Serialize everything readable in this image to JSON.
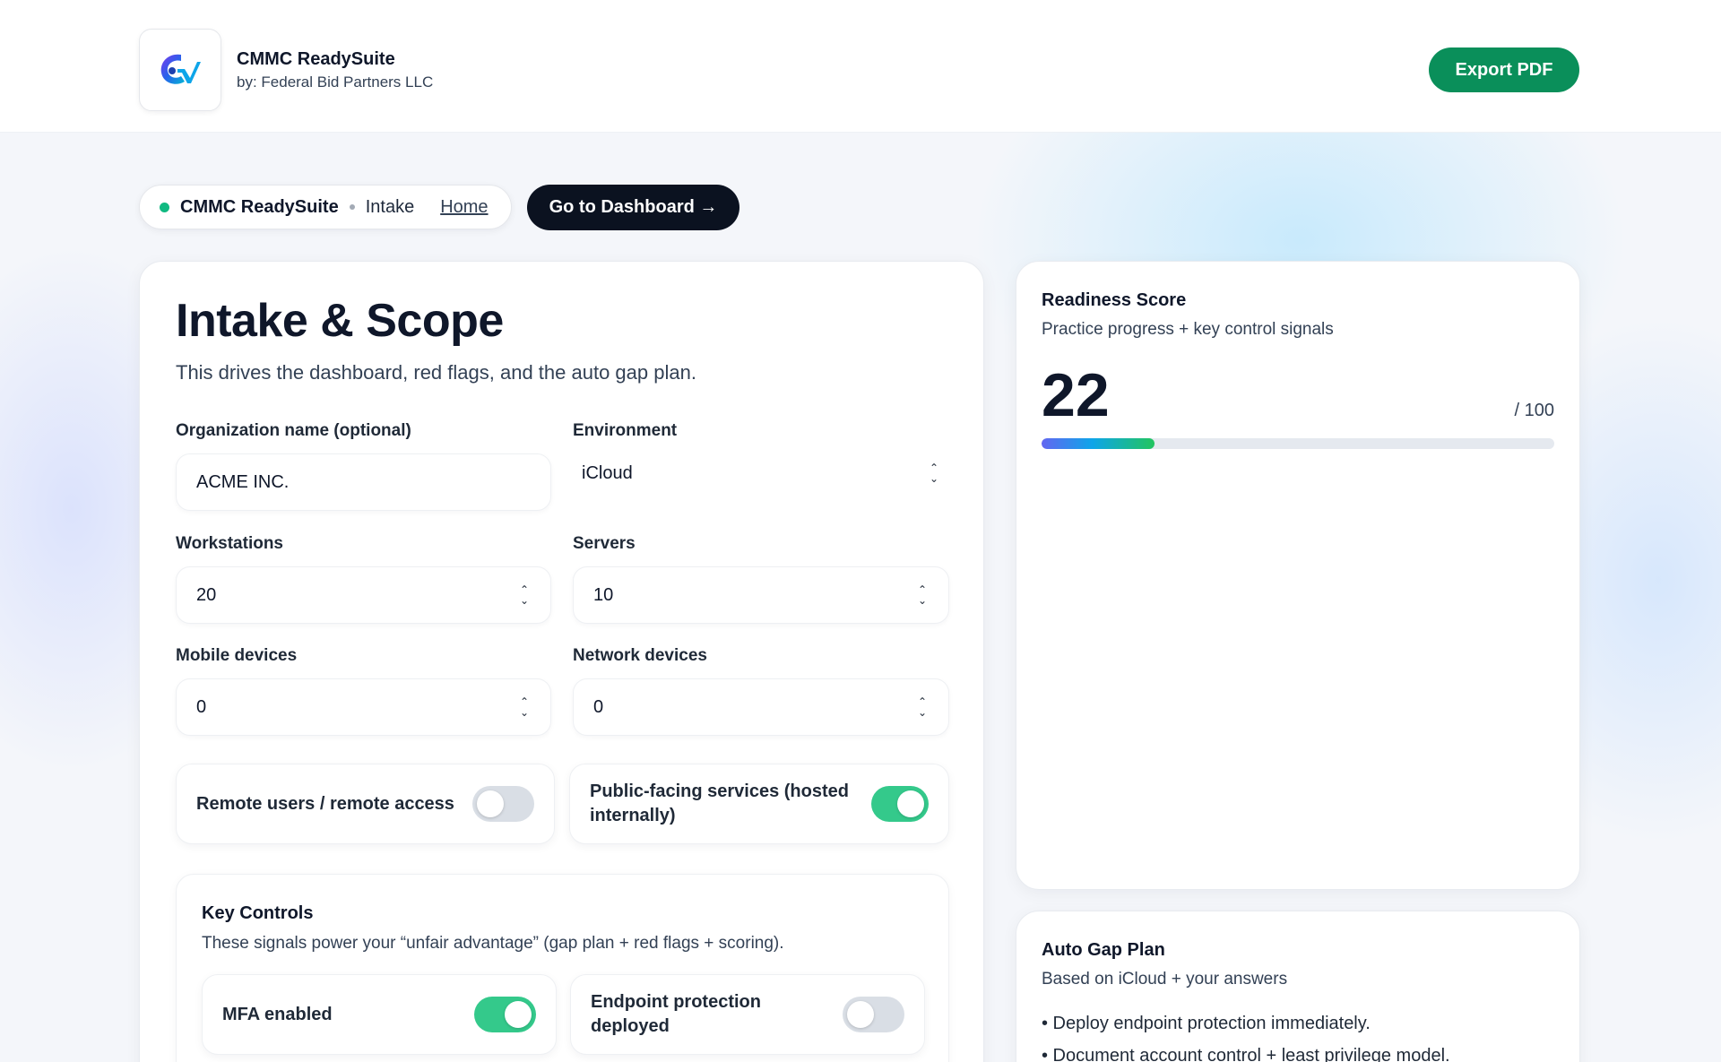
{
  "header": {
    "app_name": "CMMC ReadySuite",
    "byline": "by: Federal Bid Partners LLC",
    "export_label": "Export PDF"
  },
  "breadcrumb": {
    "app": "CMMC ReadySuite",
    "page": "Intake",
    "home_link": "Home"
  },
  "dashboard_button": "Go to Dashboard →",
  "intake": {
    "title": "Intake & Scope",
    "subtitle": "This drives the dashboard, red flags, and the auto gap plan.",
    "org_label": "Organization name (optional)",
    "org_value": "ACME INC.",
    "env_label": "Environment",
    "env_value": "iCloud",
    "workstations_label": "Workstations",
    "workstations_value": "20",
    "servers_label": "Servers",
    "servers_value": "10",
    "mobile_label": "Mobile devices",
    "mobile_value": "0",
    "network_label": "Network devices",
    "network_value": "0",
    "remote_label": "Remote users / remote access",
    "remote_on": false,
    "public_label": "Public-facing services (hosted internally)",
    "public_on": true
  },
  "key_controls": {
    "title": "Key Controls",
    "subtitle": "These signals power your “unfair advantage” (gap plan + red flags + scoring).",
    "mfa_label": "MFA enabled",
    "mfa_on": true,
    "endpoint_label": "Endpoint protection deployed",
    "endpoint_on": false
  },
  "readiness": {
    "title": "Readiness Score",
    "subtitle": "Practice progress + key control signals",
    "score": "22",
    "max": "/ 100",
    "progress_pct": 22
  },
  "gap_plan": {
    "title": "Auto Gap Plan",
    "subtitle": "Based on iCloud + your answers",
    "items": [
      "• Deploy endpoint protection immediately.",
      "• Document account control + least privilege model."
    ]
  },
  "colors": {
    "brand_green": "#0a8f5a",
    "dark_button": "#0b1220",
    "toggle_on": "#34c98b",
    "toggle_off": "#d9dee5"
  }
}
